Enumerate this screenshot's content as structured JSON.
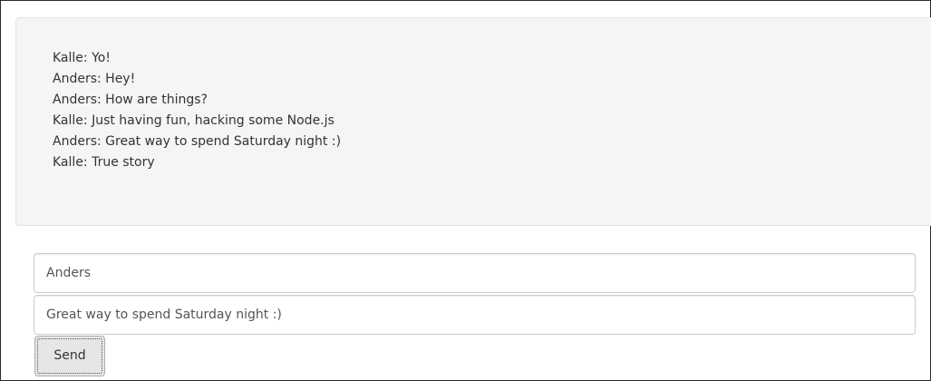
{
  "chat": {
    "messages": [
      "Kalle: Yo!",
      "Anders: Hey!",
      "Anders: How are things?",
      "Kalle: Just having fun, hacking some Node.js",
      "Anders: Great way to spend Saturday night :)",
      "Kalle: True story"
    ]
  },
  "form": {
    "name_value": "Anders",
    "message_value": "Great way to spend Saturday night :)",
    "send_label": "Send"
  }
}
